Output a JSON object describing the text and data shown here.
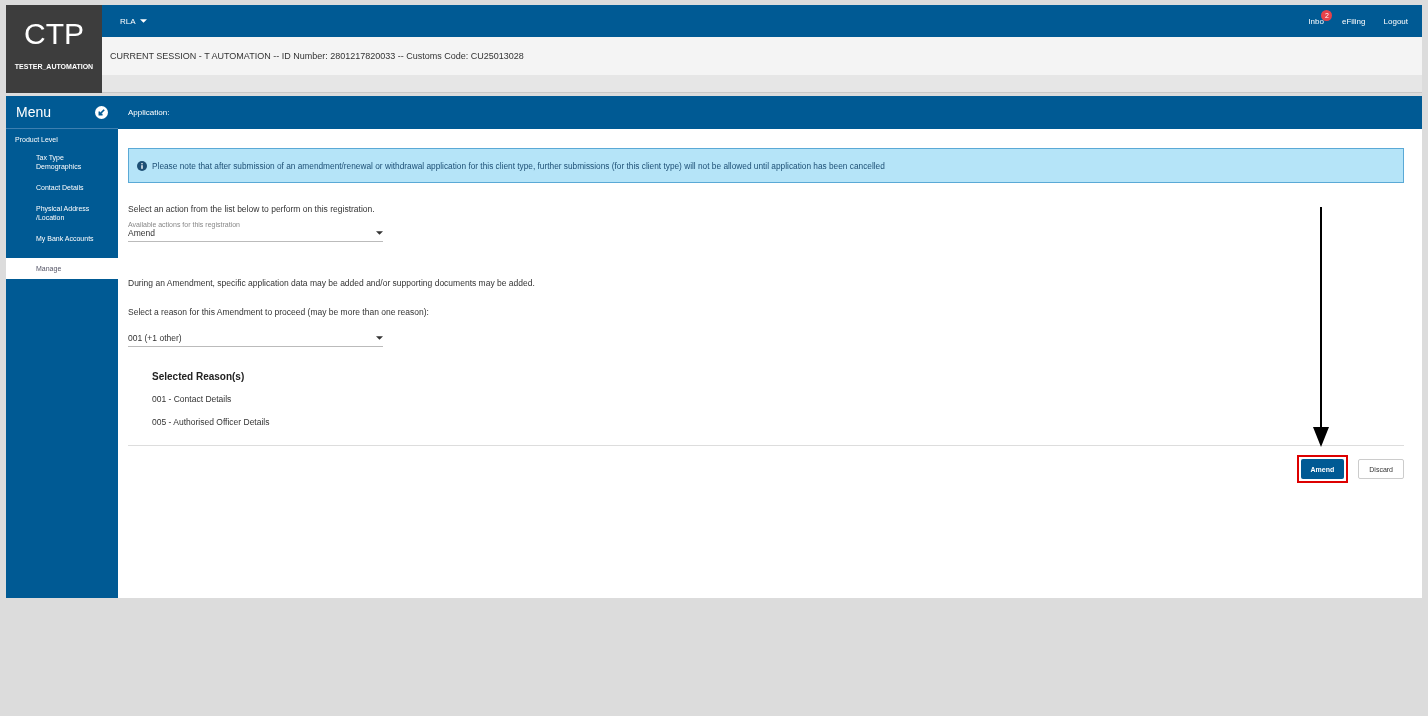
{
  "logo": {
    "title": "CTP",
    "user": "TESTER_AUTOMATION"
  },
  "topbar": {
    "menu": "RLA",
    "links": [
      {
        "label": "Inbo",
        "badge": "2"
      },
      {
        "label": "eFiling"
      },
      {
        "label": "Logout"
      }
    ]
  },
  "session": "CURRENT SESSION - T AUTOMATION -- ID Number: 2801217820033 -- Customs Code: CU25013028",
  "sidebar": {
    "title": "Menu",
    "items": [
      {
        "label": "Product Level",
        "children": [
          {
            "label": "Tax Type Demographics",
            "selected": false
          },
          {
            "label": "Contact Details",
            "selected": false
          },
          {
            "label": "Physical Address /Location",
            "selected": false
          },
          {
            "label": "My Bank Accounts",
            "selected": false
          },
          {
            "label": "Manage",
            "selected": true
          }
        ]
      }
    ]
  },
  "panel": {
    "title": "Application:",
    "notice": "Please note that after submission of an amendment/renewal or withdrawal application for this client type, further submissions (for this client type) will not be allowed until application has been cancelled",
    "action_prompt": "Select an action from the list below to perform on this registration.",
    "action_field": {
      "label": "Available actions for this registration",
      "value": "Amend"
    },
    "amend_note": "During an Amendment, specific application data may be added and/or supporting documents may be added.",
    "reason_prompt": "Select a reason for this Amendment to proceed (may be more than one reason):",
    "reason_field": {
      "value": "001 (+1 other)"
    },
    "selected_title": "Selected Reason(s)",
    "reasons": [
      "001 - Contact Details",
      "005 - Authorised Officer Details"
    ],
    "buttons": [
      {
        "label": "Amend",
        "kind": "primary",
        "highlighted": true
      },
      {
        "label": "Discard",
        "kind": "secondary",
        "highlighted": false
      }
    ]
  }
}
